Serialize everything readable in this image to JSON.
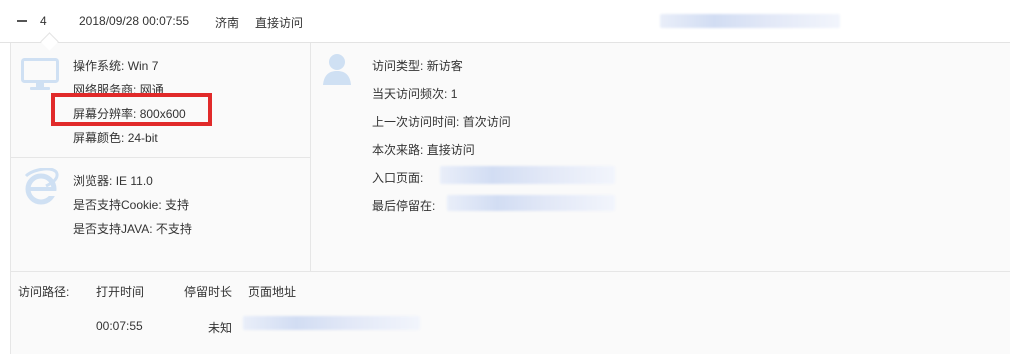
{
  "header": {
    "row_number": "4",
    "datetime": "2018/09/28 00:07:55",
    "city": "济南",
    "source": "直接访问"
  },
  "system": {
    "os_label": "操作系统:",
    "os_value": "Win 7",
    "isp_label": "网络服务商:",
    "isp_value": "网通",
    "resolution_label": "屏幕分辨率:",
    "resolution_value": "800x600",
    "color_label": "屏幕颜色:",
    "color_value": "24-bit"
  },
  "browser": {
    "browser_label": "浏览器:",
    "browser_value": "IE 11.0",
    "cookie_label": "是否支持Cookie:",
    "cookie_value": "支持",
    "java_label": "是否支持JAVA:",
    "java_value": "不支持"
  },
  "visitor": {
    "type_label": "访问类型:",
    "type_value": "新访客",
    "freq_label": "当天访问频次:",
    "freq_value": "1",
    "last_label": "上一次访问时间:",
    "last_value": "首次访问",
    "source_label": "本次来路:",
    "source_value": "直接访问",
    "entry_label": "入口页面:",
    "last_stay_label": "最后停留在:"
  },
  "path": {
    "title": "访问路径:",
    "col_open_time": "打开时间",
    "col_duration": "停留时长",
    "col_page": "页面地址",
    "rows": [
      {
        "open_time": "00:07:55",
        "duration": "未知"
      }
    ]
  },
  "colors": {
    "highlight": "#e12a2a",
    "icon_blue": "#cfe0f3",
    "panel_bg": "#fafafa"
  }
}
